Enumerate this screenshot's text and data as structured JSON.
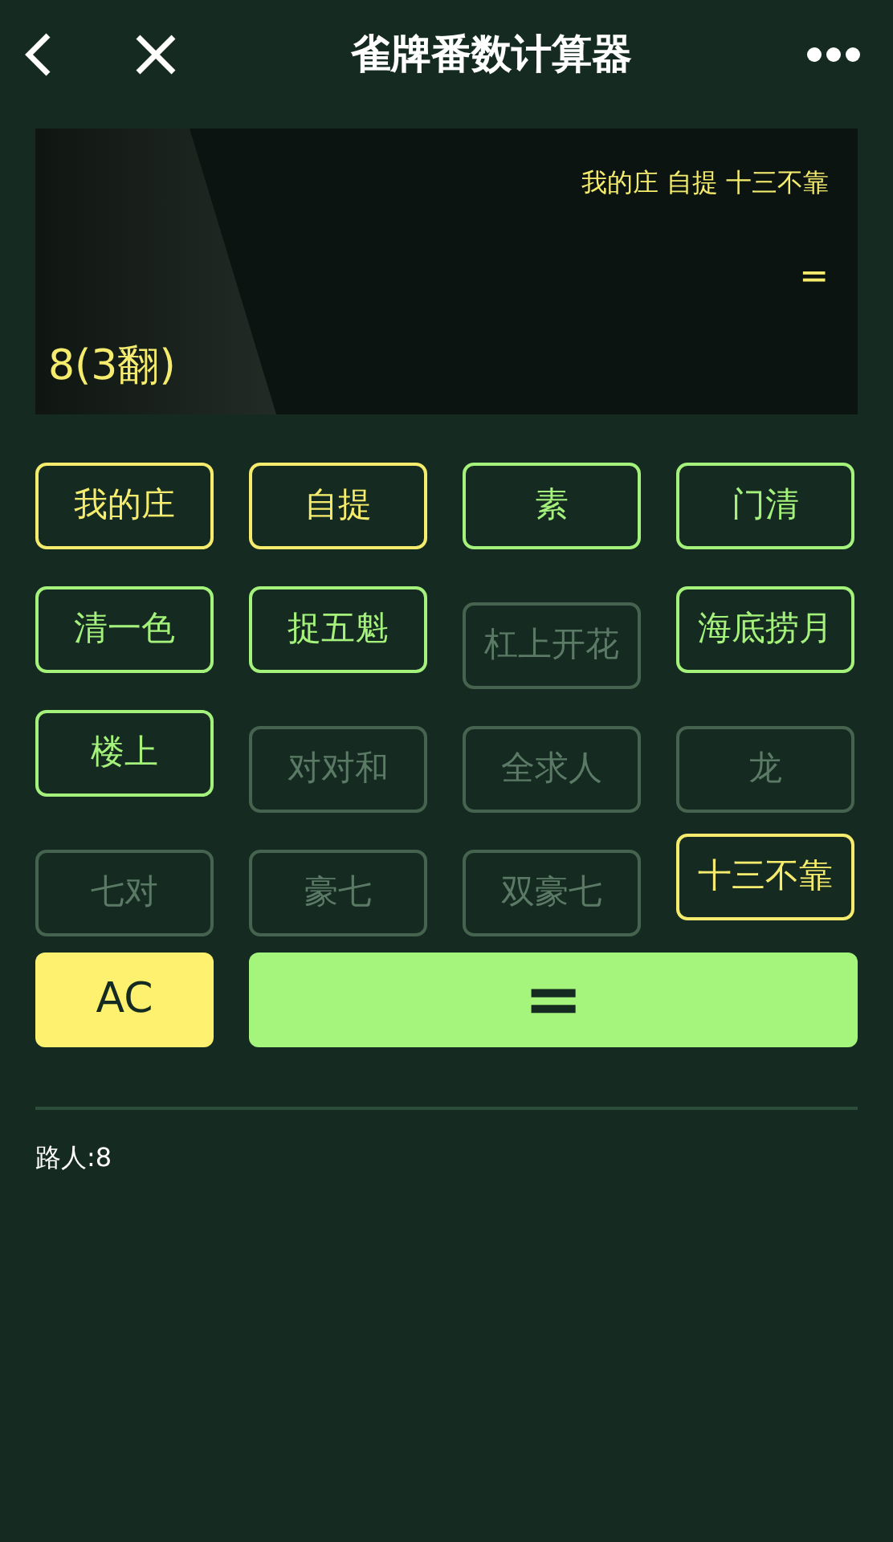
{
  "header": {
    "title": "雀牌番数计算器"
  },
  "display": {
    "selection": "我的庄 自提 十三不靠",
    "operator": "=",
    "result": "8(3翻)"
  },
  "tiles": [
    {
      "label": "我的庄",
      "selected": true,
      "disabled": false
    },
    {
      "label": "自提",
      "selected": true,
      "disabled": false
    },
    {
      "label": "素",
      "selected": false,
      "disabled": false
    },
    {
      "label": "门清",
      "selected": false,
      "disabled": false
    },
    {
      "label": "清一色",
      "selected": false,
      "disabled": false
    },
    {
      "label": "捉五魁",
      "selected": false,
      "disabled": false
    },
    {
      "label": "杠上开花",
      "selected": false,
      "disabled": true
    },
    {
      "label": "海底捞月",
      "selected": false,
      "disabled": false
    },
    {
      "label": "楼上",
      "selected": false,
      "disabled": false
    },
    {
      "label": "对对和",
      "selected": false,
      "disabled": true
    },
    {
      "label": "全求人",
      "selected": false,
      "disabled": true
    },
    {
      "label": "龙",
      "selected": false,
      "disabled": true
    },
    {
      "label": "七对",
      "selected": false,
      "disabled": true
    },
    {
      "label": "豪七",
      "selected": false,
      "disabled": true
    },
    {
      "label": "双豪七",
      "selected": false,
      "disabled": true
    },
    {
      "label": "十三不靠",
      "selected": true,
      "disabled": false
    }
  ],
  "actions": [
    {
      "label": "AC",
      "kind": "clear"
    },
    {
      "label": "=",
      "kind": "equals"
    }
  ],
  "footer": {
    "text": "路人:8"
  }
}
